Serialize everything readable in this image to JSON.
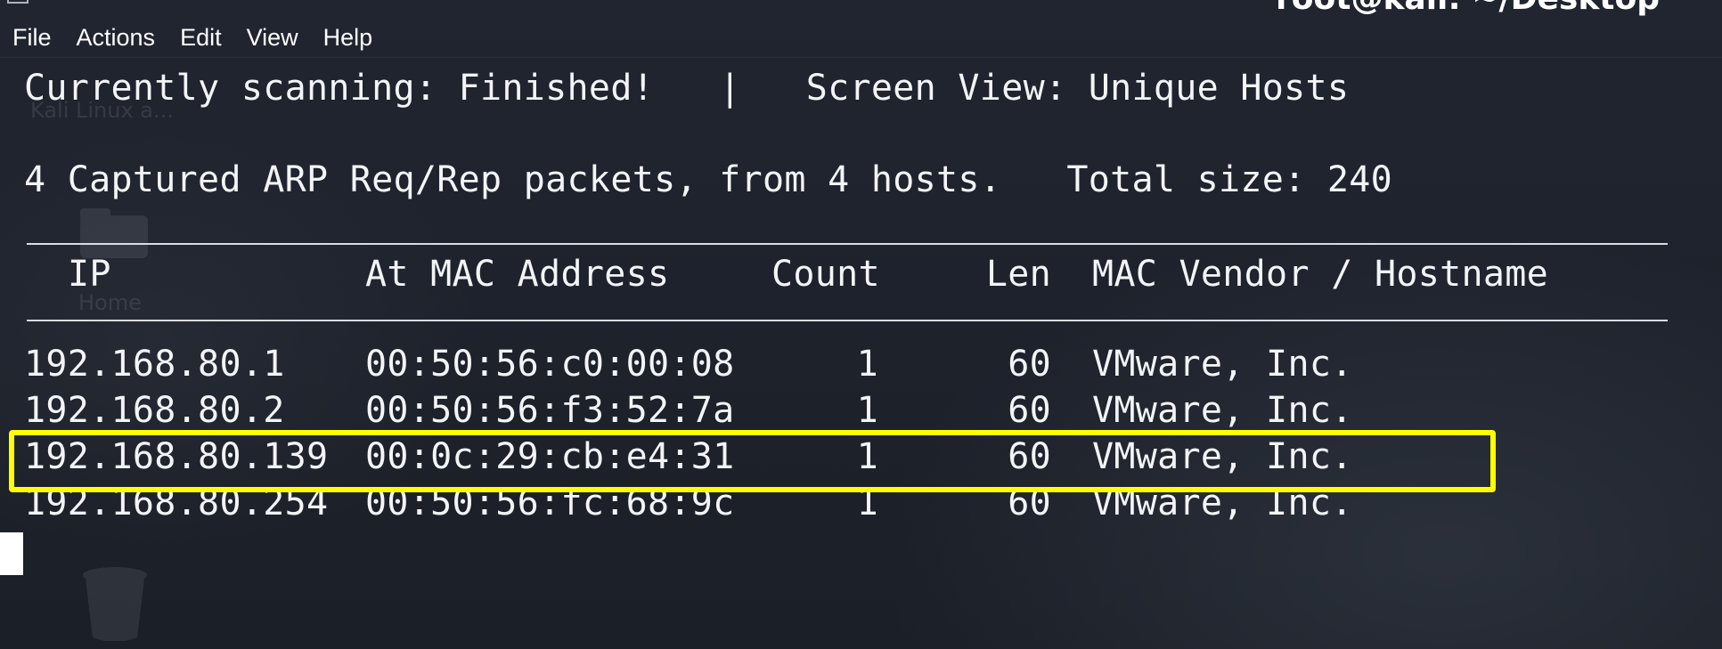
{
  "window": {
    "title": "root@kali: ~/Desktop"
  },
  "desktop": {
    "icons": [
      {
        "label": "Kali Linux a..."
      },
      {
        "label": "Home"
      }
    ]
  },
  "menu": [
    "File",
    "Actions",
    "Edit",
    "View",
    "Help"
  ],
  "status": {
    "scanning_line": "Currently scanning: Finished!   |   Screen View: Unique Hosts",
    "summary_line": "4 Captured ARP Req/Rep packets, from 4 hosts.   Total size: 240"
  },
  "table": {
    "headers": {
      "ip": "IP",
      "mac": "At MAC Address",
      "count": "Count",
      "len": "Len",
      "vendor": "MAC Vendor / Hostname"
    },
    "rows": [
      {
        "ip": "192.168.80.1",
        "mac": "00:50:56:c0:00:08",
        "count": "1",
        "len": "60",
        "vendor": "VMware, Inc."
      },
      {
        "ip": "192.168.80.2",
        "mac": "00:50:56:f3:52:7a",
        "count": "1",
        "len": "60",
        "vendor": "VMware, Inc."
      },
      {
        "ip": "192.168.80.139",
        "mac": "00:0c:29:cb:e4:31",
        "count": "1",
        "len": "60",
        "vendor": "VMware, Inc."
      },
      {
        "ip": "192.168.80.254",
        "mac": "00:50:56:fc:68:9c",
        "count": "1",
        "len": "60",
        "vendor": "VMware, Inc."
      }
    ]
  },
  "colors": {
    "background": "#1d2129",
    "text": "#f2f4f7",
    "highlight": "#ffff00"
  },
  "icons": {
    "window": "terminal-window-icon",
    "desktop_home": "home-folder-icon",
    "desktop_trash": "trash-icon"
  }
}
